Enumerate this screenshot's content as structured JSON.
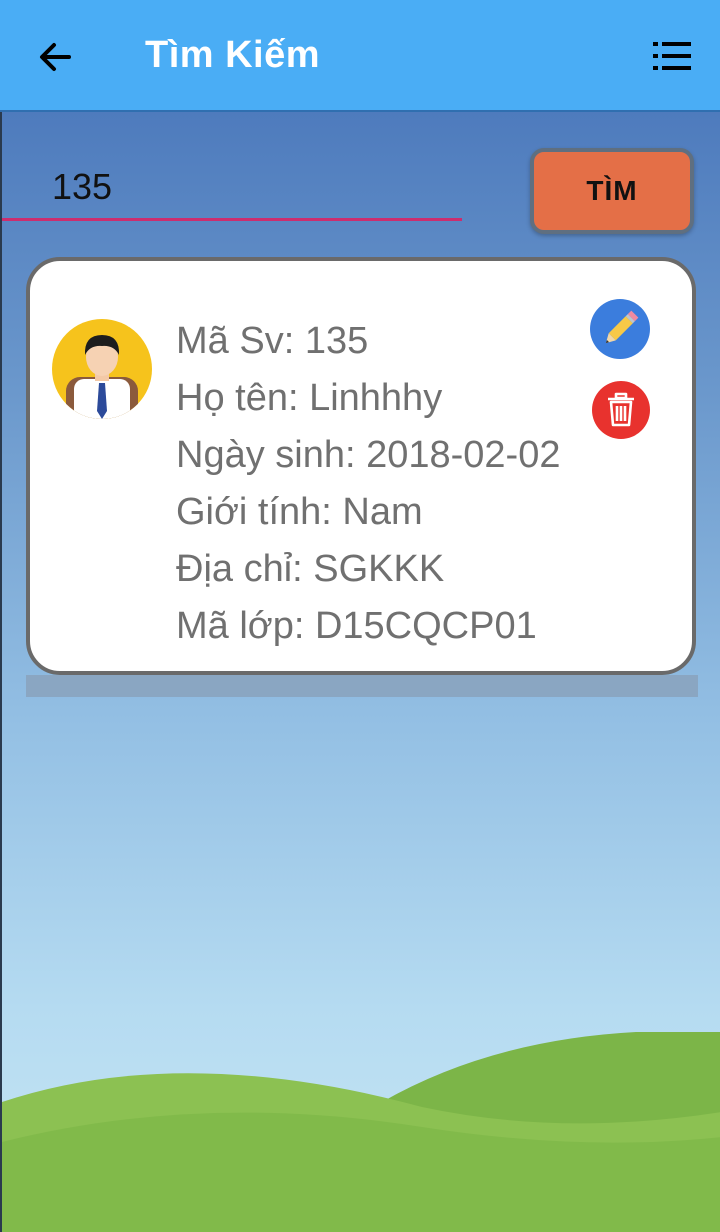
{
  "header": {
    "title": "Tìm Kiếm",
    "back_icon": "arrow-left-icon",
    "menu_icon": "list-menu-icon",
    "background_color": "#4aadf5"
  },
  "search": {
    "value": "135",
    "button_label": "TÌM",
    "underline_color": "#cc2d6e",
    "button_color": "#e46f47"
  },
  "result": {
    "avatar_icon": "student-avatar-icon",
    "fields": [
      {
        "label": "Mã Sv: ",
        "value": "135"
      },
      {
        "label": "Họ tên: ",
        "value": "Linhhhy"
      },
      {
        "label": "Ngày sinh: ",
        "value": "2018-02-02"
      },
      {
        "label": "Giới tính: ",
        "value": "Nam"
      },
      {
        "label": "Địa chỉ: ",
        "value": "SGKKK"
      },
      {
        "label": "Mã lớp: ",
        "value": "D15CQCP01"
      }
    ],
    "edit_icon": "pencil-icon",
    "delete_icon": "trash-icon",
    "edit_color": "#3b7ddd",
    "delete_color": "#e8322e"
  }
}
